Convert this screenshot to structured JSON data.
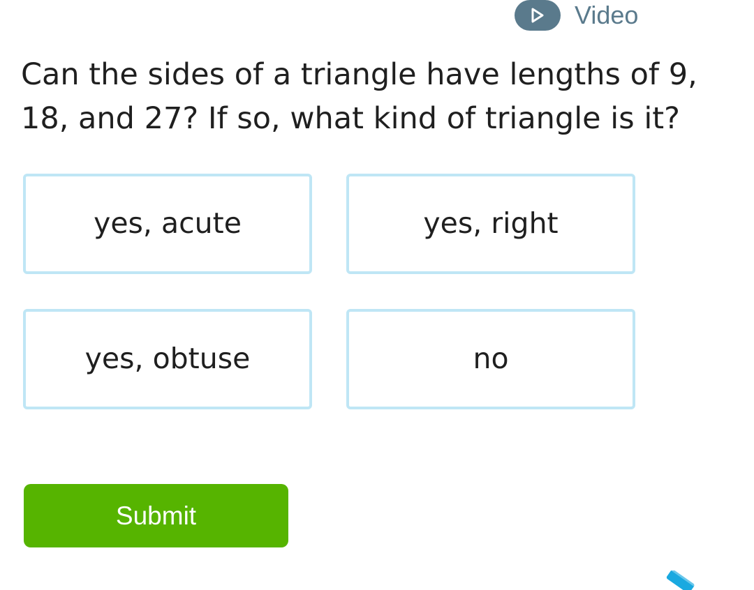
{
  "video": {
    "icon": "play-icon",
    "label": "Video"
  },
  "question": {
    "text": "Can the sides of a triangle have lengths of 9, 18, and 27? If so, what kind of triangle is it?"
  },
  "choices": [
    {
      "label": "yes, acute"
    },
    {
      "label": "yes, right"
    },
    {
      "label": "yes, obtuse"
    },
    {
      "label": "no"
    }
  ],
  "submit": {
    "label": "Submit"
  },
  "scratchpad": {
    "icon": "pencil-icon"
  },
  "colors": {
    "video_accent": "#5a7a8c",
    "choice_border": "#bfe6f5",
    "submit_bg": "#56b400",
    "pencil": "#1aa9e0"
  }
}
